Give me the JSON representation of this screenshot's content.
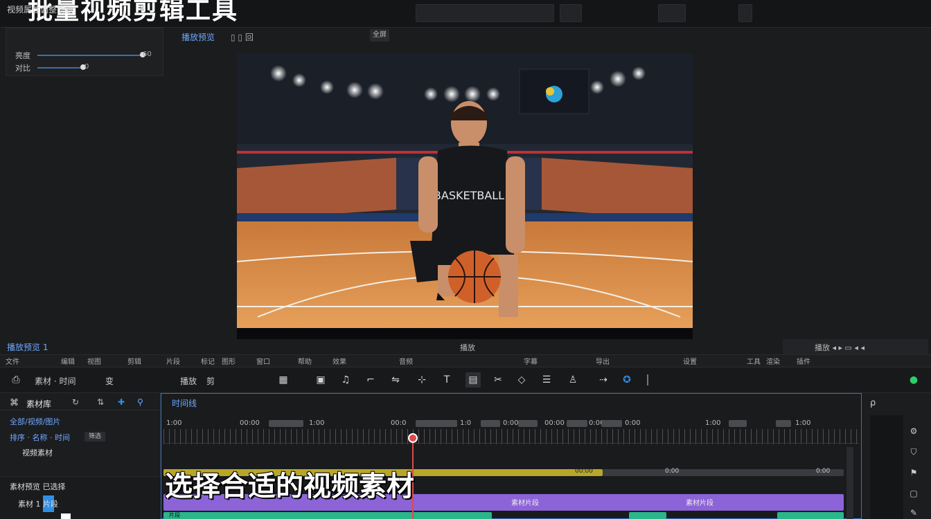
{
  "window": {
    "top_title": "批量视频剪辑工具"
  },
  "properties_panel": {
    "title": "视频属性调整面板",
    "close_icon": "close-x-icon",
    "sliders": [
      {
        "label": "亮度",
        "value_label": "60",
        "value": 0.98
      },
      {
        "label": "对比",
        "value_label": "0",
        "value": 0.42
      }
    ]
  },
  "preview": {
    "tab_label": "播放预览",
    "tab_extra": "▯ ▯ 回",
    "button_label": "全屏",
    "video_label": "播放",
    "scene_description_alt": "basketball player kneeling with ball in arena"
  },
  "info_bar": {
    "left_text": "播放预览 1",
    "right_text": "播放 ◂ ▸ ▭ ◂ ◂"
  },
  "menu_bar": {
    "items": [
      "文件",
      "编辑",
      "视图",
      "剪辑",
      "片段",
      "标记",
      "图形",
      "窗口",
      "帮助",
      "效果",
      "音频",
      "字幕",
      "导出",
      "设置",
      "工具",
      "渲染",
      "插件"
    ]
  },
  "toolbar": {
    "left_labels": [
      "素材 · 时间",
      "变",
      "播放",
      "剪"
    ],
    "tools": [
      "select-icon",
      "music-icon",
      "crop-icon",
      "transition-icon",
      "add-marker-icon",
      "text-icon",
      "screen-icon",
      "cut-icon",
      "shape-icon",
      "layer-icon",
      "person-icon",
      "link-icon",
      "brand-icon"
    ]
  },
  "media_panel": {
    "title": "素材库",
    "filter": "全部/视频/图片",
    "sub_filter": "排序 · 名称 · 时间",
    "chip": "筛选",
    "item": "视频素材",
    "footer_title": "素材预览  已选择",
    "footer_item": "素材 1   片段"
  },
  "timeline": {
    "tab_label": "时间线",
    "timecodes": [
      "1:00",
      "00:00",
      "1:00",
      "00:0",
      "1:0",
      "0:00",
      "00:00",
      "0:00",
      "0:00",
      "1:00",
      "1:00"
    ],
    "clips": {
      "yellow_label": "00:00",
      "yellow_label2": "0:00",
      "purple_label": "素材片段",
      "green_label": "片段"
    }
  },
  "subtitle_caption": "选择合适的视频素材",
  "right_panel": {
    "icons": [
      "settings-icon",
      "shield-icon",
      "flag-icon",
      "lock-icon",
      "pen-icon"
    ]
  }
}
